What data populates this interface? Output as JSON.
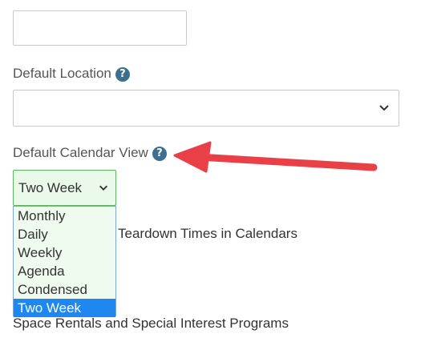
{
  "top_input": {
    "value": ""
  },
  "default_location": {
    "label": "Default Location",
    "help_glyph": "?",
    "selected_value": "",
    "icon": "chevron-down-icon"
  },
  "default_calendar_view": {
    "label": "Default Calendar View",
    "help_glyph": "?",
    "selected_value": "Two Week",
    "options": [
      "Monthly",
      "Daily",
      "Weekly",
      "Agenda",
      "Condensed",
      "Two Week"
    ],
    "highlighted_option": "Two Week"
  },
  "background_text": {
    "teardown_label": "Teardown Times in Calendars",
    "space_rentals_label": "Space Rentals and Special Interest Programs"
  },
  "annotation": {
    "arrow_color": "#e84046"
  },
  "colors": {
    "help_icon": "#3e6f8f",
    "select_focus_border": "#5cb85c",
    "option_highlight": "#1e87f0"
  }
}
